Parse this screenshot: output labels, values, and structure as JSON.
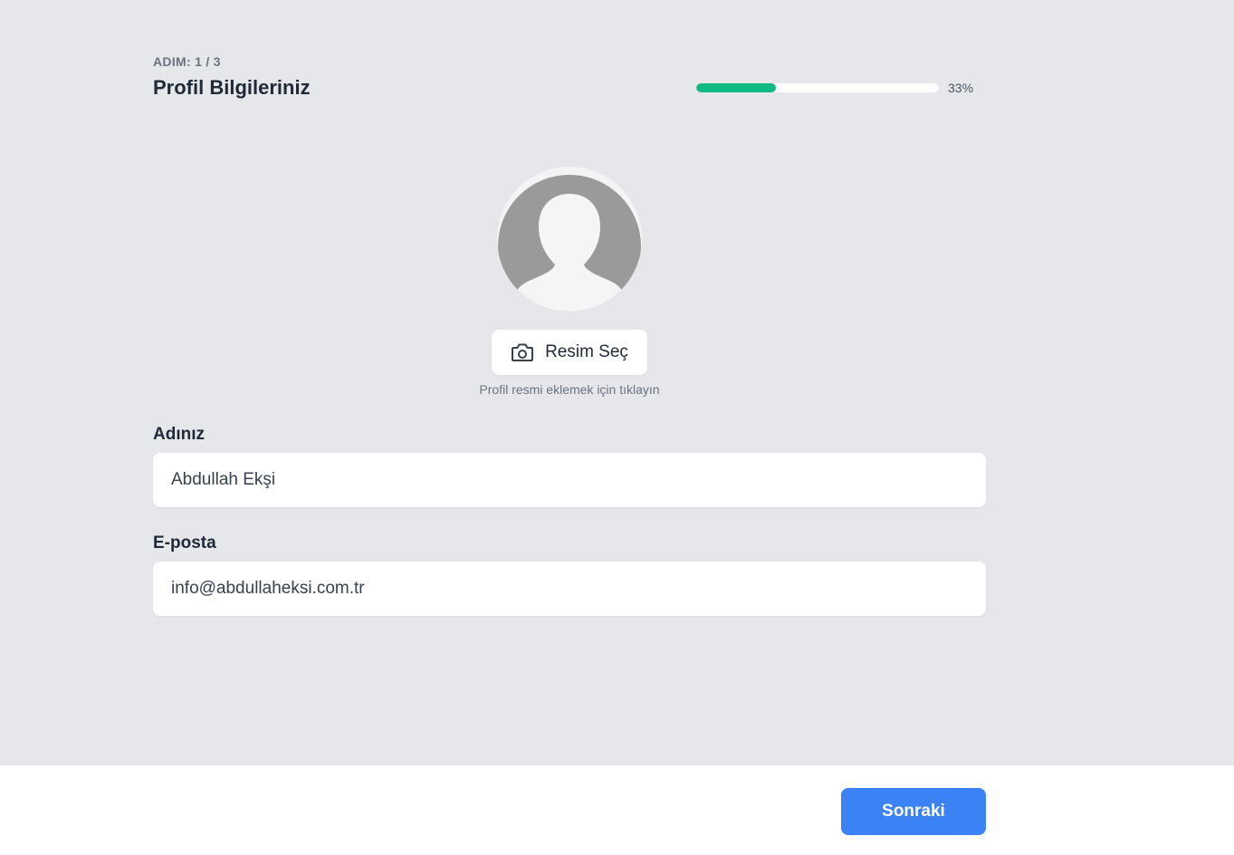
{
  "header": {
    "step_label": "ADIM: 1 / 3",
    "title": "Profil Bilgileriniz",
    "progress_percent": 33,
    "progress_text": "33%",
    "progress_color": "#10b981"
  },
  "avatar": {
    "icon": "user-silhouette-icon",
    "select_button_label": "Resim Seç",
    "select_button_icon": "camera-icon",
    "hint": "Profil resmi eklemek için tıklayın"
  },
  "form": {
    "name_label": "Adınız",
    "name_value": "Abdullah Ekşi",
    "email_label": "E-posta",
    "email_value": "info@abdullaheksi.com.tr"
  },
  "footer": {
    "next_label": "Sonraki",
    "next_color": "#3b82f6"
  }
}
